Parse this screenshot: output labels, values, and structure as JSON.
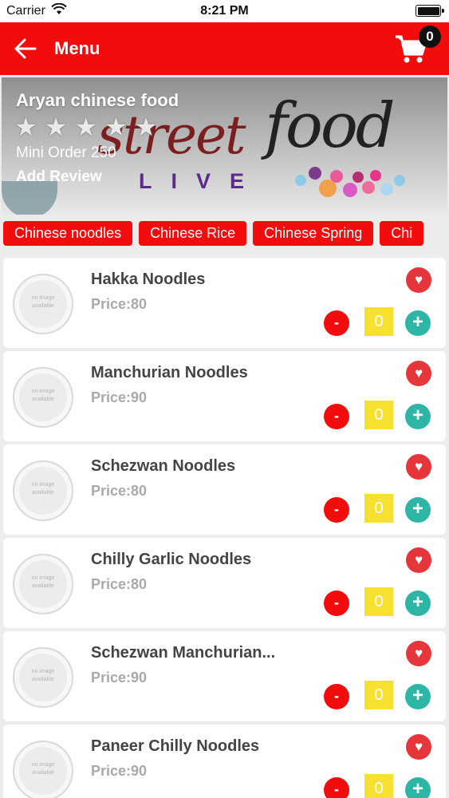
{
  "status_bar": {
    "carrier": "Carrier",
    "time": "8:21 PM"
  },
  "app_bar": {
    "title": "Menu",
    "cart_count": "0"
  },
  "restaurant": {
    "name": "Aryan chinese food",
    "rating_stars": 5,
    "min_order": "Mini Order 250",
    "add_review": "Add Review"
  },
  "categories": [
    "Chinese noodles",
    "Chinese Rice",
    "Chinese Spring",
    "Chi"
  ],
  "items": [
    {
      "name": "Hakka Noodles",
      "price": "Price:80",
      "qty": "0"
    },
    {
      "name": "Manchurian Noodles",
      "price": "Price:90",
      "qty": "0"
    },
    {
      "name": "Schezwan Noodles",
      "price": "Price:80",
      "qty": "0"
    },
    {
      "name": "Chilly Garlic Noodles",
      "price": "Price:80",
      "qty": "0"
    },
    {
      "name": "Schezwan Manchurian...",
      "price": "Price:90",
      "qty": "0"
    },
    {
      "name": "Paneer Chilly Noodles",
      "price": "Price:90",
      "qty": "0"
    }
  ],
  "item_controls": {
    "minus": "-",
    "plus": "+",
    "no_image": "no image available"
  },
  "colors": {
    "primary": "#f20c0c",
    "favorite": "#e6353b",
    "plus": "#2db6a5",
    "qty_bg": "#f5e12e"
  }
}
